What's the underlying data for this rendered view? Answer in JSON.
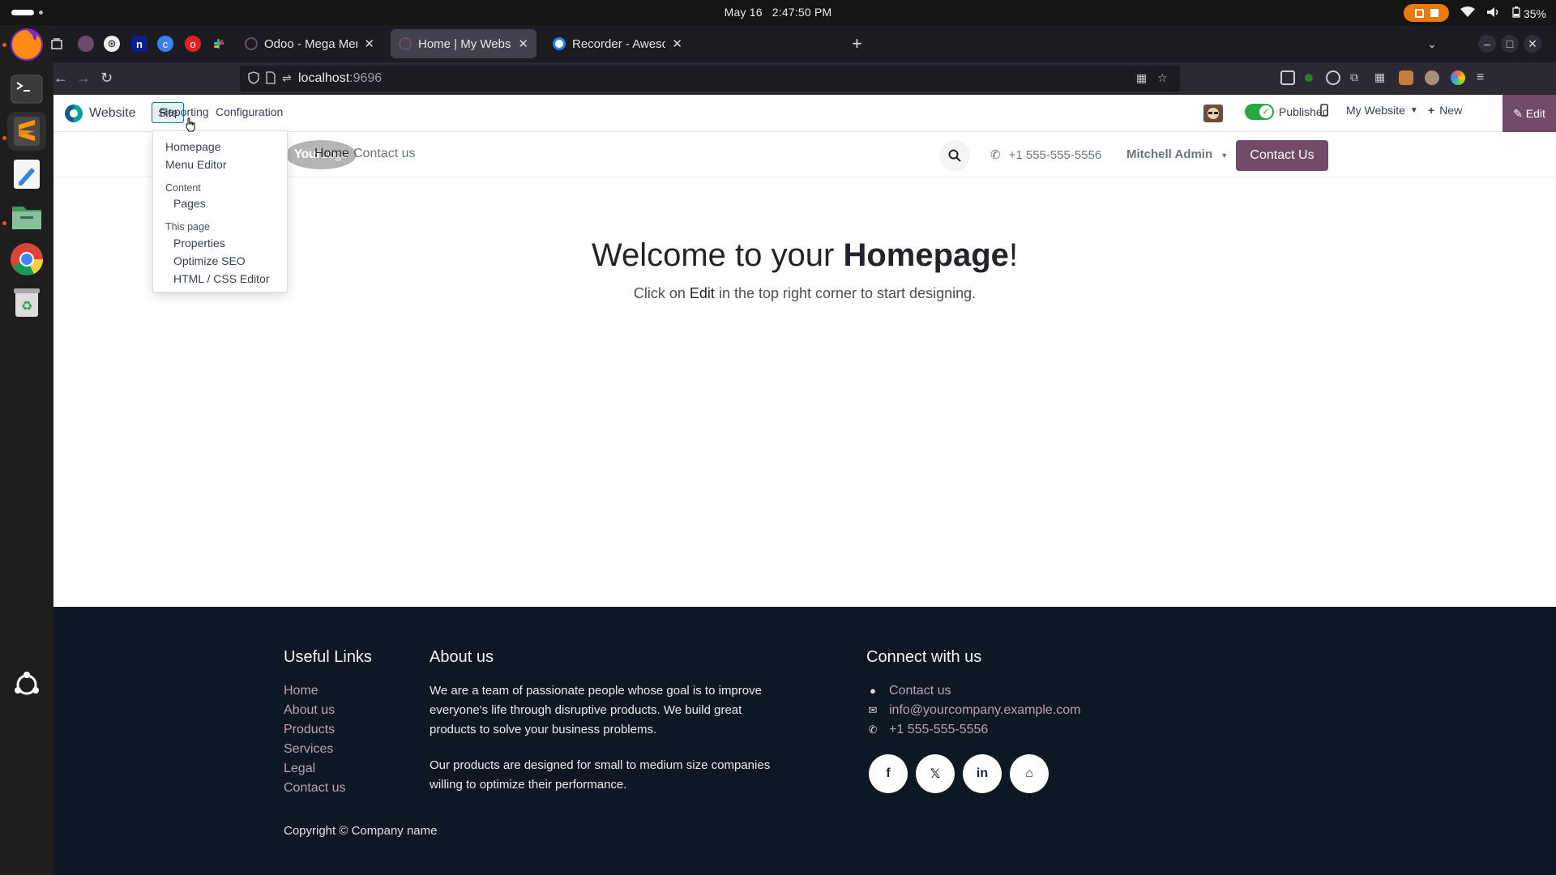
{
  "system": {
    "date": "May 16",
    "time": "2:47:50 PM",
    "battery": "35%"
  },
  "browser": {
    "tabs": [
      {
        "title": "Odoo - Mega Menu URL S",
        "favicon_color": "#6b4b6b"
      },
      {
        "title": "Home | My Website",
        "favicon_color": "#714b67"
      },
      {
        "title": "Recorder - Awesome Scre",
        "favicon_color": "#2b7de9"
      }
    ],
    "url_host": "localhost",
    "url_port": ":9696"
  },
  "odoo_bar": {
    "app_name": "Website",
    "menus": [
      "Site",
      "Reporting",
      "Configuration"
    ],
    "published_label": "Published",
    "website_switcher": "My Website",
    "new_label": "New",
    "edit_label": "Edit"
  },
  "site_dropdown": {
    "items": [
      "Homepage",
      "Menu Editor"
    ],
    "content_header": "Content",
    "content_items": [
      "Pages"
    ],
    "thispage_header": "This page",
    "thispage_items": [
      "Properties",
      "Optimize SEO",
      "HTML / CSS Editor"
    ]
  },
  "site_header": {
    "logo_text_bold": "Your",
    "logo_text": "Logo",
    "nav": [
      "Home",
      "Contact us"
    ],
    "phone": "+1 555-555-5556",
    "user": "Mitchell Admin",
    "cta": "Contact Us"
  },
  "hero": {
    "title_pre": "Welcome to your ",
    "title_bold": "Homepage",
    "title_post": "!",
    "sub_pre": "Click on ",
    "sub_bold": "Edit",
    "sub_post": " in the top right corner to start designing."
  },
  "footer": {
    "useful_links_title": "Useful Links",
    "useful_links": [
      "Home",
      "About us",
      "Products",
      "Services",
      "Legal",
      "Contact us"
    ],
    "about_title": "About us",
    "about_p1": "We are a team of passionate people whose goal is to improve everyone's life through disruptive products. We build great products to solve your business problems.",
    "about_p2": "Our products are designed for small to medium size companies willing to optimize their performance.",
    "connect_title": "Connect with us",
    "contact_link": "Contact us",
    "email": "info@yourcompany.example.com",
    "phone": "+1 555-555-5556",
    "copyright": "Copyright © Company name"
  },
  "colors": {
    "odoo_purple": "#714b67",
    "footer_bg": "#0e1823",
    "footer_link": "#b9a2b4",
    "publish_green": "#28a745"
  }
}
